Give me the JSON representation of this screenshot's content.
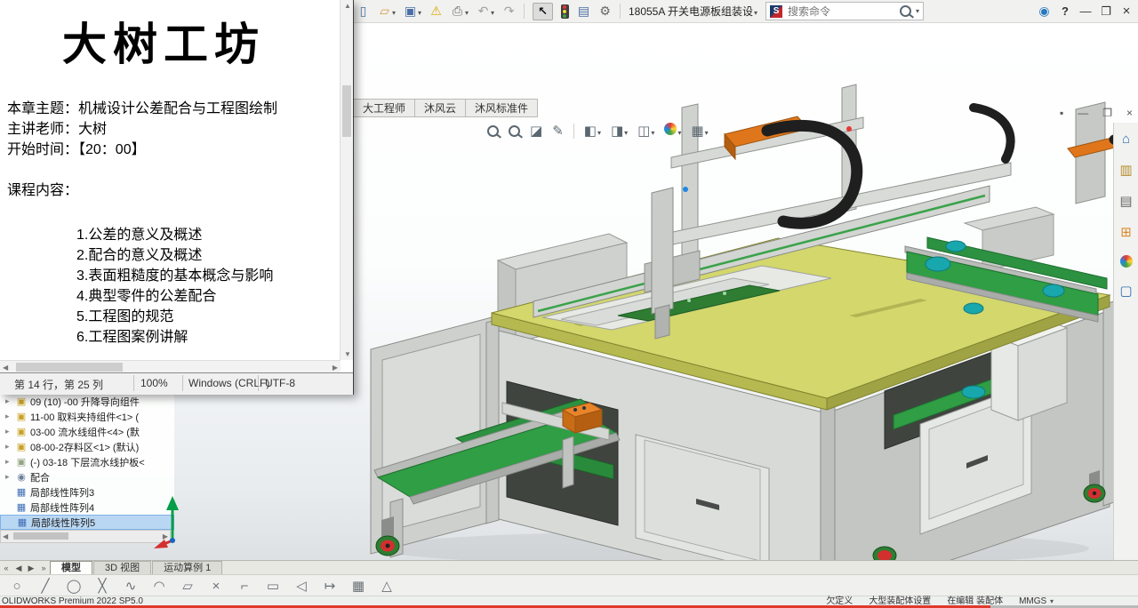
{
  "colors": {
    "selection": "#b9d7f3",
    "progress_red": "#e0392e",
    "table_top": "#d3d76c",
    "conveyor_green": "#2f9e44",
    "roller_teal": "#18a7ad",
    "actuator_orange": "#e0761b"
  },
  "titlebar": {
    "doc_title": "18055A 开关电源板组装设",
    "search_placeholder": "搜索命令",
    "logo_letter": "S"
  },
  "icons": {
    "new_doc": "▯",
    "open": "▱",
    "save": "▣",
    "warning": "⚠",
    "print": "⎙",
    "undo": "↶",
    "redo": "↷",
    "cursor": "↖",
    "list": "▤",
    "gear": "⚙",
    "caret": "▾",
    "user": "◉",
    "help": "?",
    "minimize": "—",
    "restore": "❐",
    "close": "×",
    "section_view": "◪",
    "annotation": "✎",
    "display_style": "◨",
    "hide_items": "◫",
    "view_cube": "◧",
    "view_settings": "▦",
    "home": "⌂",
    "design_library": "▥",
    "file_explorer": "▤",
    "view_palette": "⊞",
    "custom_properties": "▢",
    "nav_first": "«",
    "nav_prev": "◀",
    "nav_next": "▶",
    "nav_last": "»",
    "tree_caret": "▸",
    "component": "▣",
    "mates": "◉",
    "pattern": "▦",
    "scroll_up": "▲",
    "scroll_down": "▼",
    "scroll_left": "◀",
    "scroll_right": "▶",
    "pin": "▪"
  },
  "cmd_tabs": [
    "大工程师",
    "沐风云",
    "沐风标准件"
  ],
  "notepad": {
    "brand": "大树工坊",
    "topic": "本章主题：机械设计公差配合与工程图绘制",
    "teacher": "主讲老师：大树",
    "start_time": "开始时间：【20：00】",
    "content_heading": "课程内容：",
    "outline": [
      "1.公差的意义及概述",
      "2.配合的意义及概述",
      "3.表面粗糙度的基本概念与影响",
      "4.典型零件的公差配合",
      "5.工程图的规范",
      "6.工程图案例讲解"
    ],
    "status": {
      "position": "第 14 行，第 25 列",
      "zoom": "100%",
      "eol": "Windows (CRLF)",
      "encoding": "UTF-8"
    }
  },
  "tree": {
    "items": [
      {
        "label": "09 (10) -00 升降导向组件",
        "type": "component"
      },
      {
        "label": "11-00 取料夹持组件<1> (",
        "type": "component"
      },
      {
        "label": "03-00 流水线组件<4> (默",
        "type": "component"
      },
      {
        "label": "08-00-2存料区<1> (默认)",
        "type": "component"
      },
      {
        "label": "(-) 03-18 下层流水线护板<",
        "type": "component"
      },
      {
        "label": "配合",
        "type": "mates"
      },
      {
        "label": "局部线性阵列3",
        "type": "pattern"
      },
      {
        "label": "局部线性阵列4",
        "type": "pattern"
      },
      {
        "label": "局部线性阵列5",
        "type": "pattern",
        "selected": true
      }
    ]
  },
  "sketch_tools": [
    {
      "name": "ellipse",
      "glyph": "○"
    },
    {
      "name": "line",
      "glyph": "╱"
    },
    {
      "name": "circle",
      "glyph": "◯"
    },
    {
      "name": "cross",
      "glyph": "╳"
    },
    {
      "name": "spline",
      "glyph": "∿"
    },
    {
      "name": "arc",
      "glyph": "◠"
    },
    {
      "name": "parallelogram",
      "glyph": "▱"
    },
    {
      "name": "erase",
      "glyph": "×"
    },
    {
      "name": "corner",
      "glyph": "⌐"
    },
    {
      "name": "rectangle",
      "glyph": "▭"
    },
    {
      "name": "mirror",
      "glyph": "◁"
    },
    {
      "name": "offset",
      "glyph": "↦"
    },
    {
      "name": "linear-pattern",
      "glyph": "▦"
    },
    {
      "name": "chamfer",
      "glyph": "△"
    }
  ],
  "bottom_tabs": [
    "模型",
    "3D 视图",
    "运动算例 1"
  ],
  "statusbar": {
    "product": "OLIDWORKS Premium 2022 SP5.0",
    "state": "欠定义",
    "assembly_mode": "大型装配体设置",
    "editing": "在编辑 装配体",
    "units": "MMGS"
  },
  "player": {
    "progress_percent": 87
  }
}
